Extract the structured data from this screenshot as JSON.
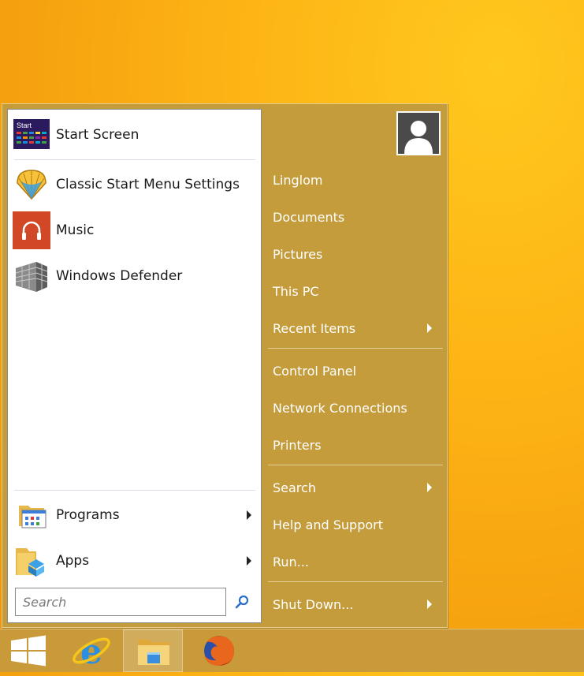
{
  "left_items": [
    {
      "label": "Start Screen",
      "icon": "start-screen-icon"
    },
    {
      "label": "Classic Start Menu Settings",
      "icon": "shell-icon"
    },
    {
      "label": "Music",
      "icon": "headphones-icon"
    },
    {
      "label": "Windows Defender",
      "icon": "brick-wall-icon"
    }
  ],
  "start_tile_text": "Start",
  "bottom_items": [
    {
      "label": "Programs",
      "icon": "programs-folder-icon"
    },
    {
      "label": "Apps",
      "icon": "apps-folder-icon"
    }
  ],
  "search": {
    "placeholder": "Search",
    "value": ""
  },
  "right_items": [
    "Linglom",
    "Documents",
    "Pictures",
    "This PC",
    "Recent Items",
    "Control Panel",
    "Network Connections",
    "Printers",
    "Search",
    "Help and Support",
    "Run...",
    "Shut Down..."
  ],
  "taskbar": [
    "windows-logo-icon",
    "internet-explorer-icon",
    "file-explorer-icon",
    "firefox-icon"
  ],
  "colors": {
    "menu_bg": "#c49c3c",
    "desktop": "#fdb515",
    "music_tile": "#d24726",
    "start_tile": "#2b1a5e"
  }
}
